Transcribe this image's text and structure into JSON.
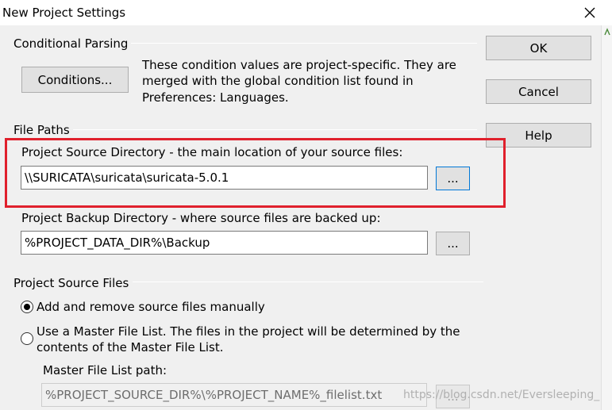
{
  "window": {
    "title": "New Project Settings",
    "close_icon": "close-icon"
  },
  "conditional_parsing": {
    "heading": "Conditional Parsing",
    "button_label": "Conditions...",
    "desc_line1": "These condition values are project-specific.  They are",
    "desc_line2": "merged with the global condition list found in",
    "desc_line3": "Preferences: Languages."
  },
  "dialog_buttons": {
    "ok": "OK",
    "cancel": "Cancel",
    "help": "Help"
  },
  "file_paths": {
    "heading": "File Paths",
    "source_label": "Project Source Directory - the main location of your source files:",
    "source_value": "\\\\SURICATA\\suricata\\suricata-5.0.1",
    "source_browse": "...",
    "backup_label": "Project Backup Directory - where source files are backed up:",
    "backup_value": "%PROJECT_DATA_DIR%\\Backup",
    "backup_browse": "..."
  },
  "source_files": {
    "heading": "Project Source Files",
    "option_manual": "Add and remove source files manually",
    "option_master_line1": "Use a Master File List. The files in the project will be determined by the",
    "option_master_line2": "contents of the Master File List.",
    "selected": "manual",
    "master_path_label": "Master File List path:",
    "master_path_value": "%PROJECT_SOURCE_DIR%\\%PROJECT_NAME%_filelist.txt",
    "master_browse": "..."
  },
  "annotation": {
    "highlight_color": "#e0202c",
    "watermark": "https://blog.csdn.net/Eversleeping_"
  }
}
